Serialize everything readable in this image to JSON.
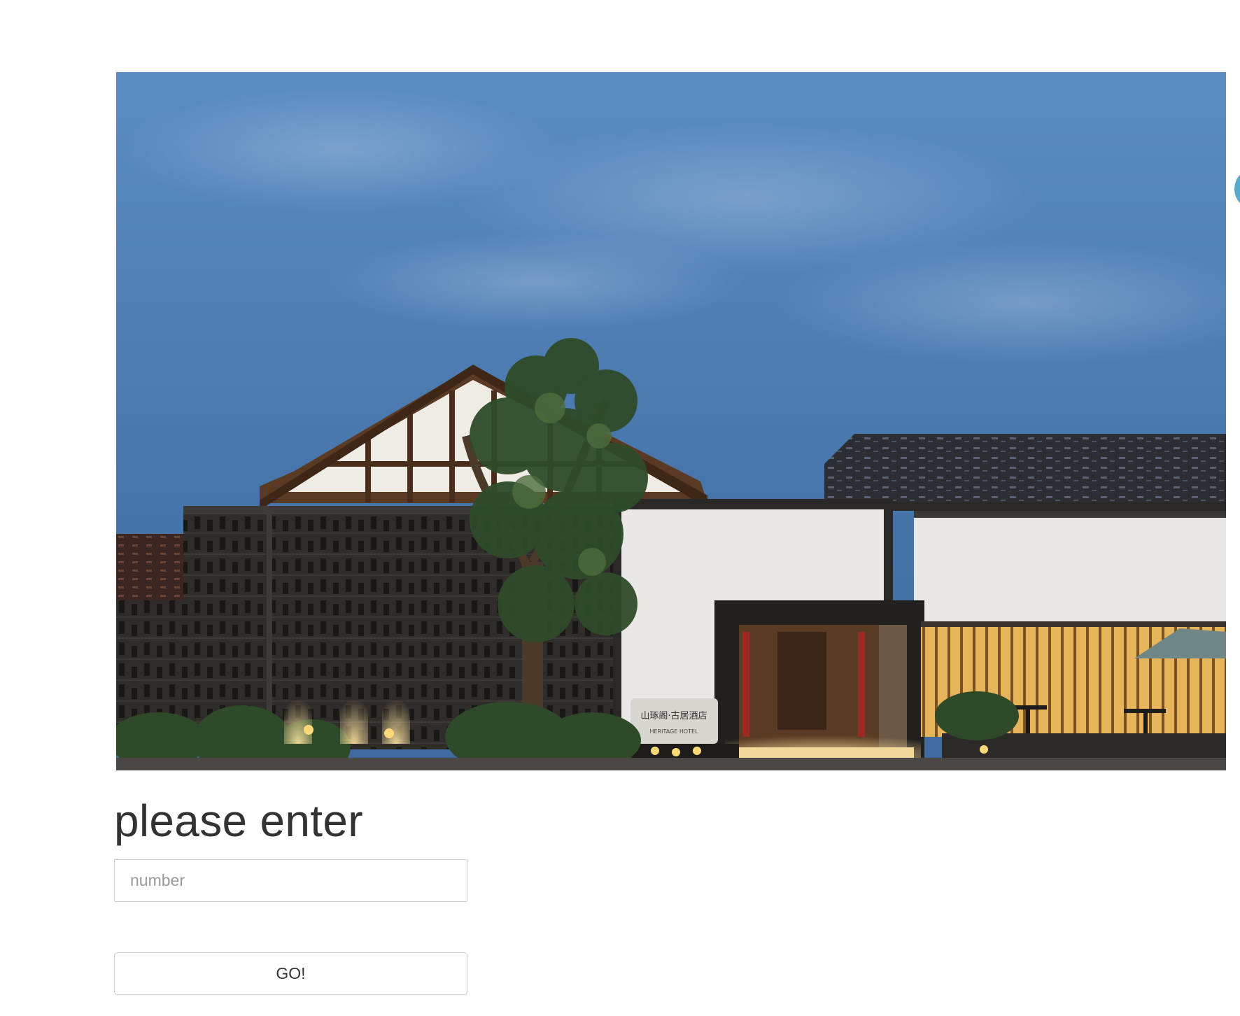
{
  "form": {
    "heading": "please enter",
    "input_placeholder": "number",
    "input_value": "",
    "submit_label": "GO!"
  },
  "hero_image": {
    "sign_text_cn": "山琢阁·古居酒店",
    "sign_text_en": "HERITAGE HOTEL"
  },
  "colors": {
    "sky": "#4a7fb8",
    "wall_white": "#e9e8e6",
    "brick_dark": "#2e2b29",
    "warm_light": "#f2c870",
    "border": "#cccccc",
    "text": "#333333",
    "accent_circle": "#5aa8cc"
  }
}
